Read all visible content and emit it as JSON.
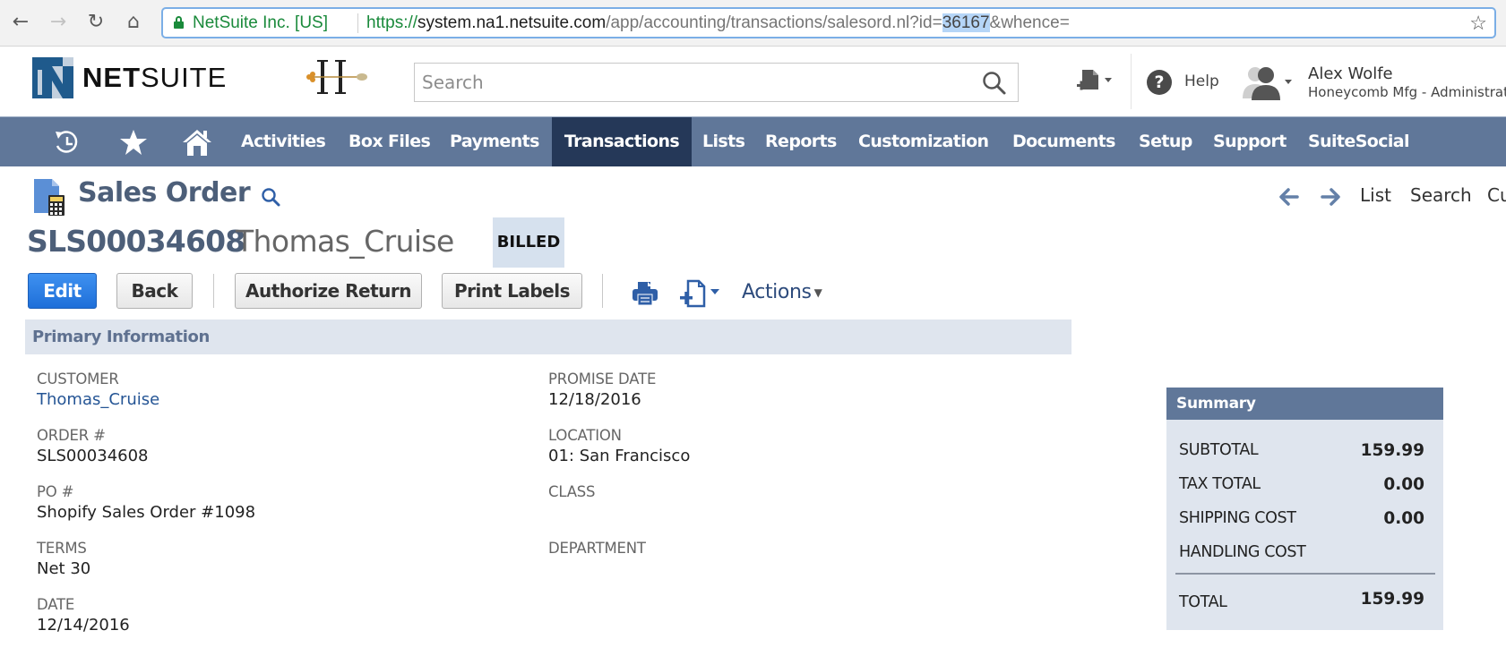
{
  "browser": {
    "back_icon": "arrow-left-icon",
    "forward_icon": "arrow-right-icon",
    "reload_icon": "reload-icon",
    "home_icon": "home-icon",
    "cert_label": "NetSuite Inc. [US]",
    "url_scheme": "https://",
    "url_host": "system.na1.netsuite.com",
    "url_path": "/app/accounting/transactions/salesord.nl?id=",
    "url_selected": "36167",
    "url_tail": "&whence=",
    "bookmark_icon": "star-outline-icon"
  },
  "header": {
    "logo_bold": "NET",
    "logo_rest": "SUITE",
    "search_placeholder": "Search",
    "help_label": "Help",
    "user_name": "Alex Wolfe",
    "user_role": "Honeycomb Mfg - Administrator"
  },
  "nav": {
    "icons": [
      "recent-history-icon",
      "favorites-star-icon",
      "home-icon"
    ],
    "items": [
      {
        "label": "Activities",
        "active": false
      },
      {
        "label": "Box Files",
        "active": false
      },
      {
        "label": "Payments",
        "active": false
      },
      {
        "label": "Transactions",
        "active": true
      },
      {
        "label": "Lists",
        "active": false
      },
      {
        "label": "Reports",
        "active": false
      },
      {
        "label": "Customization",
        "active": false
      },
      {
        "label": "Documents",
        "active": false
      },
      {
        "label": "Setup",
        "active": false
      },
      {
        "label": "Support",
        "active": false
      },
      {
        "label": "SuiteSocial",
        "active": false
      }
    ]
  },
  "page": {
    "title": "Sales Order",
    "record_number": "SLS00034608",
    "record_name": "Thomas_Cruise",
    "status": "BILLED",
    "record_nav": {
      "list": "List",
      "search": "Search",
      "customize_partial": "Cu"
    }
  },
  "toolbar": {
    "edit": "Edit",
    "back": "Back",
    "authorize_return": "Authorize Return",
    "print_labels": "Print Labels",
    "actions": "Actions"
  },
  "primary_info": {
    "section_title": "Primary Information",
    "left_fields": [
      {
        "label": "CUSTOMER",
        "value": "Thomas_Cruise",
        "link": true
      },
      {
        "label": "ORDER #",
        "value": "SLS00034608",
        "link": false
      },
      {
        "label": "PO #",
        "value": "Shopify Sales Order #1098",
        "link": false
      },
      {
        "label": "TERMS",
        "value": "Net 30",
        "link": false
      },
      {
        "label": "DATE",
        "value": "12/14/2016",
        "link": false
      }
    ],
    "right_fields": [
      {
        "label": "PROMISE DATE",
        "value": "12/18/2016"
      },
      {
        "label": "LOCATION",
        "value": "01: San Francisco"
      },
      {
        "label": "CLASS",
        "value": ""
      },
      {
        "label": "DEPARTMENT",
        "value": ""
      }
    ]
  },
  "summary": {
    "title": "Summary",
    "rows": [
      {
        "label": "SUBTOTAL",
        "value": "159.99"
      },
      {
        "label": "TAX TOTAL",
        "value": "0.00"
      },
      {
        "label": "SHIPPING COST",
        "value": "0.00"
      },
      {
        "label": "HANDLING COST",
        "value": ""
      }
    ],
    "total_label": "TOTAL",
    "total_value": "159.99"
  },
  "colors": {
    "nav_bg": "#607799",
    "nav_active": "#253858",
    "title_text": "#4d5f79",
    "primary_button": "#2a7de6",
    "section_bg": "#dfe5ee",
    "link": "#255595"
  }
}
